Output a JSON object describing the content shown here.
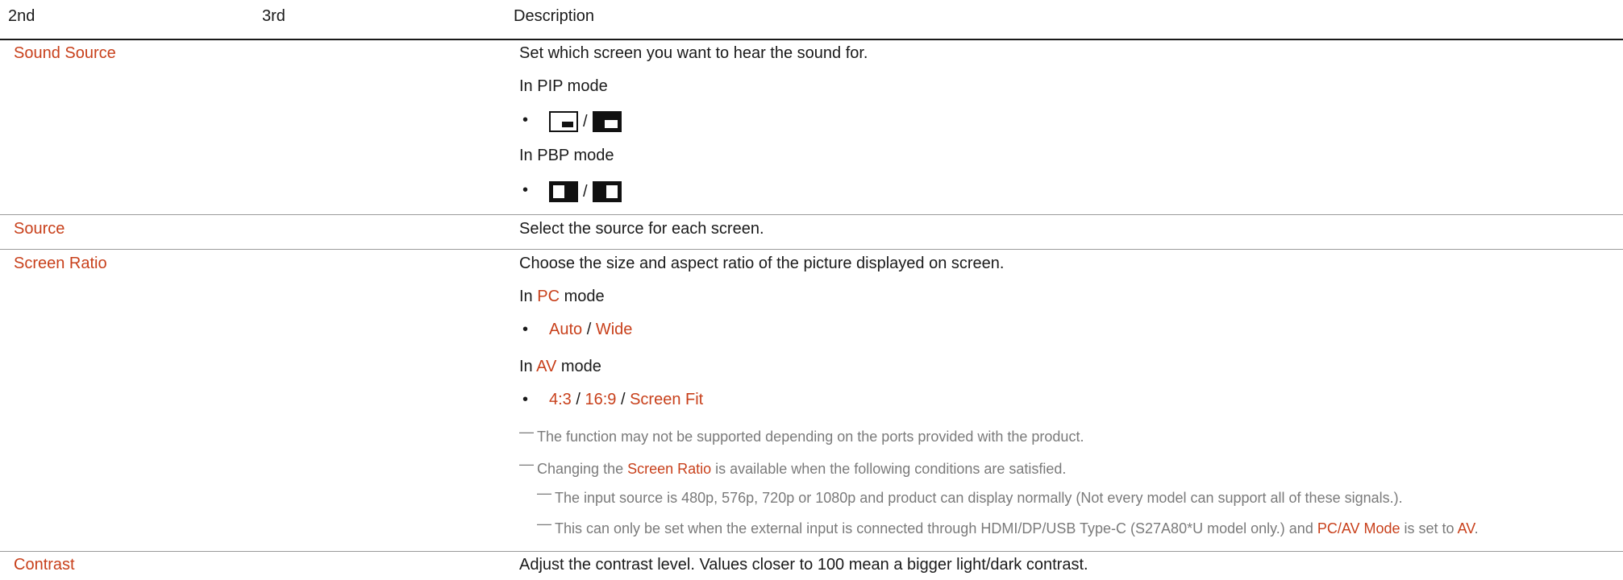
{
  "header": {
    "col1": "2nd",
    "col2": "3rd",
    "col3": "Description"
  },
  "rows": {
    "sound_source": {
      "name": "Sound Source",
      "desc": "Set which screen you want to hear the sound for.",
      "pip_mode": "In PIP mode",
      "pbp_mode": "In PBP mode",
      "separator": "/"
    },
    "source": {
      "name": "Source",
      "desc": "Select the source for each screen."
    },
    "screen_ratio": {
      "name": "Screen Ratio",
      "desc": "Choose the size and aspect ratio of the picture displayed on screen.",
      "pc_prefix": "In ",
      "pc_label": "PC",
      "pc_suffix": " mode",
      "pc_opt1": "Auto",
      "pc_opt2": "Wide",
      "av_prefix": "In ",
      "av_label": "AV",
      "av_suffix": " mode",
      "av_opt1": "4:3",
      "av_opt2": "16:9",
      "av_opt3": "Screen Fit",
      "separator": " / ",
      "note1": "The function may not be supported depending on the ports provided with the product.",
      "note2_prefix": "Changing the ",
      "note2_hl": "Screen Ratio",
      "note2_suffix": " is available when the following conditions are satisfied.",
      "note3": "The input source is 480p, 576p, 720p or 1080p and product can display normally (Not every model can support all of these signals.).",
      "note4_prefix": "This can only be set when the external input is connected through HDMI/DP/USB Type-C (S27A80*U model only.) and ",
      "note4_hl1": "PC/AV Mode",
      "note4_mid": " is set to ",
      "note4_hl2": "AV",
      "note4_end": "."
    },
    "contrast": {
      "name": "Contrast",
      "desc": "Adjust the contrast level. Values closer to 100 mean a bigger light/dark contrast."
    }
  },
  "glyphs": {
    "bullet": "•",
    "note_dash": "—"
  },
  "colors": {
    "accent": "#c8401b",
    "text": "#1a1a1a",
    "note": "#7a7a7a",
    "rule": "#9a9a9a"
  },
  "icons": {
    "pip_a": "pip-small-window-icon",
    "pip_b": "pip-large-window-icon",
    "pbp_a": "pbp-left-active-icon",
    "pbp_b": "pbp-right-active-icon"
  }
}
